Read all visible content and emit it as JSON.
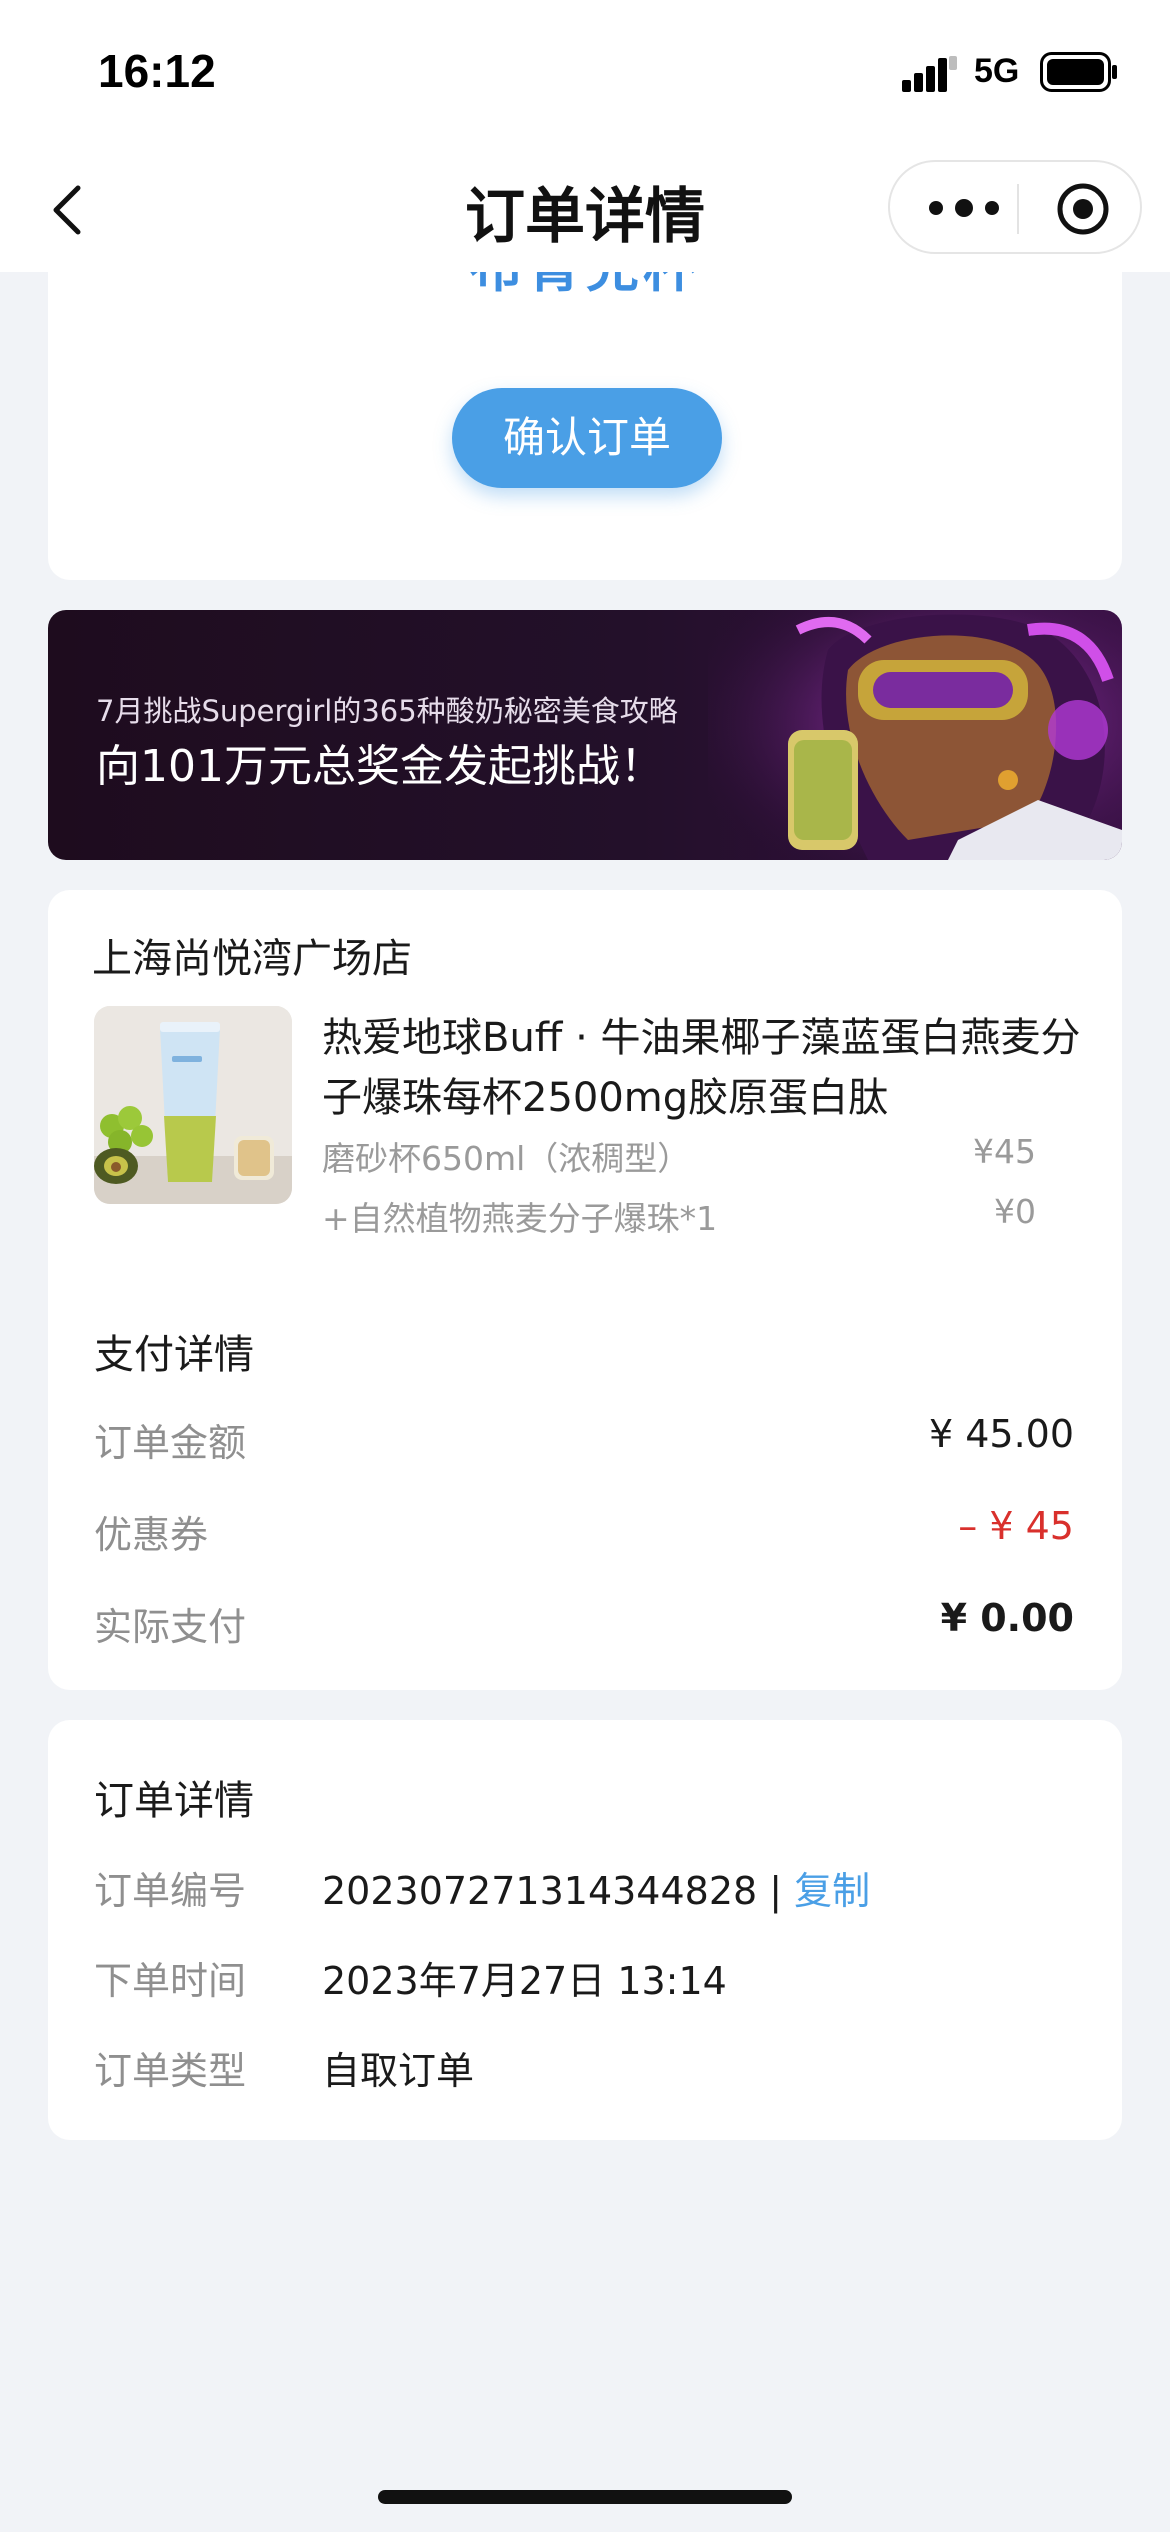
{
  "status_bar": {
    "time": "16:12",
    "network": "5G"
  },
  "nav": {
    "title": "订单详情"
  },
  "top_card": {
    "cut_text": "布青兑杯",
    "confirm_button": "确认订单"
  },
  "banner": {
    "subtitle": "7月挑战Supergirl的365种酸奶秘密美食攻略",
    "title": "向101万元总奖金发起挑战！"
  },
  "store": {
    "name": "上海尚悦湾广场店",
    "product_name": "热爱地球Buff · 牛油果椰子藻蓝蛋白燕麦分子爆珠每杯2500mg胶原蛋白肽",
    "specs": [
      {
        "label": "磨砂杯650ml（浓稠型）",
        "price": "¥45"
      },
      {
        "label": "+自然植物燕麦分子爆珠*1",
        "price": "¥0"
      }
    ]
  },
  "payment": {
    "title": "支付详情",
    "rows": [
      {
        "label": "订单金额",
        "value": "¥ 45.00"
      },
      {
        "label": "优惠券",
        "value": "– ¥ 45"
      },
      {
        "label": "实际支付",
        "value": "¥ 0.00"
      }
    ],
    "colors": {
      "discount": "#d9302c"
    }
  },
  "order_info": {
    "title": "订单详情",
    "rows": [
      {
        "label": "订单编号",
        "value": "2023072713143448​28"
      },
      {
        "label": "下单时间",
        "value": "2023年7月27日 13:14"
      },
      {
        "label": "订单类型",
        "value": "自取订单"
      }
    ],
    "copy_separator": " | ",
    "copy_label": "复制"
  },
  "colors": {
    "accent": "#4a9fe6",
    "background": "#f1f3f7"
  }
}
